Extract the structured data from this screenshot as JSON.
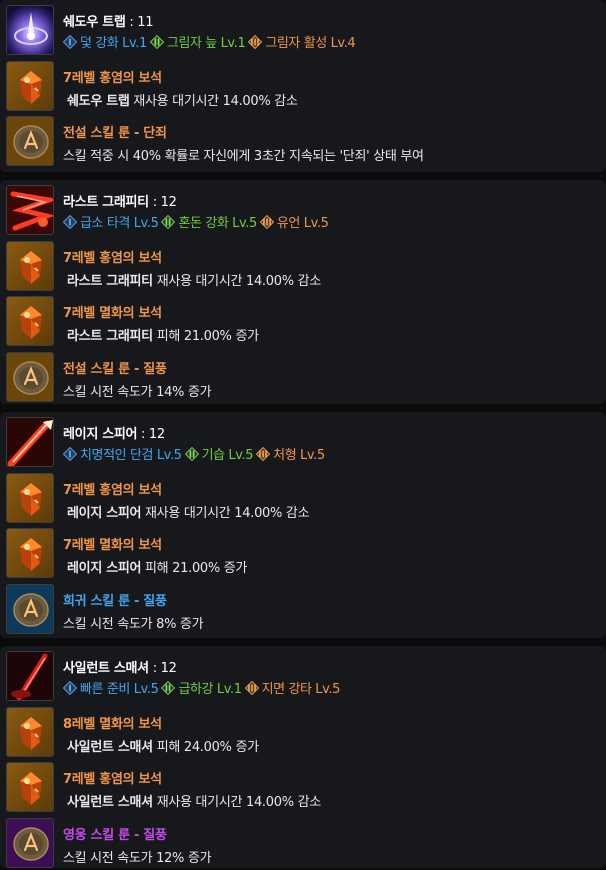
{
  "colors": {
    "gem": "#f0954a",
    "rune_legend": "#f0954a",
    "rune_rare": "#41a6f0",
    "rune_hero": "#c94bf0",
    "tripod_1": "#41a6f0",
    "tripod_2": "#6fcc43",
    "tripod_3": "#f0954a"
  },
  "skills": [
    {
      "name": "쉐도우 트랩",
      "level": " : 11",
      "icon": "shadow-trap-icon",
      "tripods": [
        {
          "tier": "1",
          "text": "덫 강화 Lv.1"
        },
        {
          "tier": "2",
          "text": "그림자 늪 Lv.1"
        },
        {
          "tier": "3",
          "text": "그림자 활성 Lv.4"
        }
      ],
      "items": [
        {
          "kind": "gem",
          "icon": "gem-icon",
          "title": "7레벨 홍염의 보석",
          "skill": "쉐도우 트랩",
          "desc": " 재사용 대기시간 14.00% 감소"
        },
        {
          "kind": "rune_legend",
          "icon": "rune-icon",
          "title": "전설 스킬 룬 - 단죄",
          "skill": "",
          "desc": "스킬 적중 시 40% 확률로 자신에게 3초간 지속되는 '단죄' 상태 부여"
        }
      ]
    },
    {
      "name": "라스트 그래피티",
      "level": " : 12",
      "icon": "last-graffiti-icon",
      "tripods": [
        {
          "tier": "1",
          "text": "급소 타격 Lv.5"
        },
        {
          "tier": "2",
          "text": "혼돈 강화 Lv.5"
        },
        {
          "tier": "3",
          "text": "유언 Lv.5"
        }
      ],
      "items": [
        {
          "kind": "gem",
          "icon": "gem-icon",
          "title": "7레벨 홍염의 보석",
          "skill": "라스트 그래피티",
          "desc": " 재사용 대기시간 14.00% 감소"
        },
        {
          "kind": "gem",
          "icon": "gem-icon",
          "title": "7레벨 멸화의 보석",
          "skill": "라스트 그래피티",
          "desc": " 피해 21.00% 증가"
        },
        {
          "kind": "rune_legend",
          "icon": "rune-icon",
          "title": "전설 스킬 룬 - 질풍",
          "skill": "",
          "desc": "스킬 시전 속도가 14% 증가"
        }
      ]
    },
    {
      "name": "레이지 스피어",
      "level": " : 12",
      "icon": "rage-spear-icon",
      "tripods": [
        {
          "tier": "1",
          "text": "치명적인 단검 Lv.5"
        },
        {
          "tier": "2",
          "text": "기습 Lv.5"
        },
        {
          "tier": "3",
          "text": "처형 Lv.5"
        }
      ],
      "items": [
        {
          "kind": "gem",
          "icon": "gem-icon",
          "title": "7레벨 홍염의 보석",
          "skill": "레이지 스피어",
          "desc": " 재사용 대기시간 14.00% 감소"
        },
        {
          "kind": "gem",
          "icon": "gem-icon",
          "title": "7레벨 멸화의 보석",
          "skill": "레이지 스피어",
          "desc": " 피해 21.00% 증가"
        },
        {
          "kind": "rune_rare",
          "icon": "rune-icon",
          "title": "희귀 스킬 룬 - 질풍",
          "skill": "",
          "desc": "스킬 시전 속도가 8% 증가"
        }
      ]
    },
    {
      "name": "사일런트 스매셔",
      "level": " : 12",
      "icon": "silent-smasher-icon",
      "tripods": [
        {
          "tier": "1",
          "text": "빠른 준비 Lv.5"
        },
        {
          "tier": "2",
          "text": "급하강 Lv.1"
        },
        {
          "tier": "3",
          "text": "지면 강타 Lv.5"
        }
      ],
      "items": [
        {
          "kind": "gem",
          "icon": "gem-icon",
          "title": "8레벨 멸화의 보석",
          "skill": "사일런트 스매셔",
          "desc": " 피해 24.00% 증가"
        },
        {
          "kind": "gem",
          "icon": "gem-icon",
          "title": "7레벨 홍염의 보석",
          "skill": "사일런트 스매셔",
          "desc": " 재사용 대기시간 14.00% 감소"
        },
        {
          "kind": "rune_hero",
          "icon": "rune-icon",
          "title": "영웅 스킬 룬 - 질풍",
          "skill": "",
          "desc": "스킬 시전 속도가 12% 증가"
        }
      ]
    }
  ]
}
